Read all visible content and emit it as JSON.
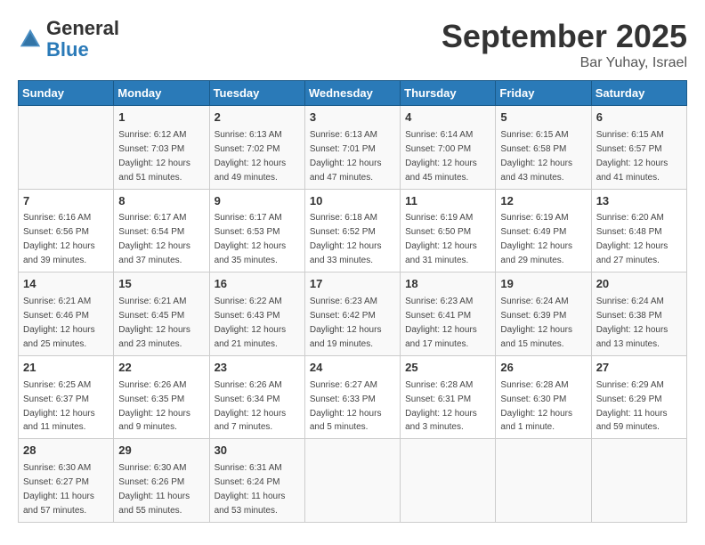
{
  "header": {
    "logo_general": "General",
    "logo_blue": "Blue",
    "month_title": "September 2025",
    "location": "Bar Yuhay, Israel"
  },
  "days_of_week": [
    "Sunday",
    "Monday",
    "Tuesday",
    "Wednesday",
    "Thursday",
    "Friday",
    "Saturday"
  ],
  "weeks": [
    [
      {
        "day": "",
        "info": ""
      },
      {
        "day": "1",
        "info": "Sunrise: 6:12 AM\nSunset: 7:03 PM\nDaylight: 12 hours\nand 51 minutes."
      },
      {
        "day": "2",
        "info": "Sunrise: 6:13 AM\nSunset: 7:02 PM\nDaylight: 12 hours\nand 49 minutes."
      },
      {
        "day": "3",
        "info": "Sunrise: 6:13 AM\nSunset: 7:01 PM\nDaylight: 12 hours\nand 47 minutes."
      },
      {
        "day": "4",
        "info": "Sunrise: 6:14 AM\nSunset: 7:00 PM\nDaylight: 12 hours\nand 45 minutes."
      },
      {
        "day": "5",
        "info": "Sunrise: 6:15 AM\nSunset: 6:58 PM\nDaylight: 12 hours\nand 43 minutes."
      },
      {
        "day": "6",
        "info": "Sunrise: 6:15 AM\nSunset: 6:57 PM\nDaylight: 12 hours\nand 41 minutes."
      }
    ],
    [
      {
        "day": "7",
        "info": "Sunrise: 6:16 AM\nSunset: 6:56 PM\nDaylight: 12 hours\nand 39 minutes."
      },
      {
        "day": "8",
        "info": "Sunrise: 6:17 AM\nSunset: 6:54 PM\nDaylight: 12 hours\nand 37 minutes."
      },
      {
        "day": "9",
        "info": "Sunrise: 6:17 AM\nSunset: 6:53 PM\nDaylight: 12 hours\nand 35 minutes."
      },
      {
        "day": "10",
        "info": "Sunrise: 6:18 AM\nSunset: 6:52 PM\nDaylight: 12 hours\nand 33 minutes."
      },
      {
        "day": "11",
        "info": "Sunrise: 6:19 AM\nSunset: 6:50 PM\nDaylight: 12 hours\nand 31 minutes."
      },
      {
        "day": "12",
        "info": "Sunrise: 6:19 AM\nSunset: 6:49 PM\nDaylight: 12 hours\nand 29 minutes."
      },
      {
        "day": "13",
        "info": "Sunrise: 6:20 AM\nSunset: 6:48 PM\nDaylight: 12 hours\nand 27 minutes."
      }
    ],
    [
      {
        "day": "14",
        "info": "Sunrise: 6:21 AM\nSunset: 6:46 PM\nDaylight: 12 hours\nand 25 minutes."
      },
      {
        "day": "15",
        "info": "Sunrise: 6:21 AM\nSunset: 6:45 PM\nDaylight: 12 hours\nand 23 minutes."
      },
      {
        "day": "16",
        "info": "Sunrise: 6:22 AM\nSunset: 6:43 PM\nDaylight: 12 hours\nand 21 minutes."
      },
      {
        "day": "17",
        "info": "Sunrise: 6:23 AM\nSunset: 6:42 PM\nDaylight: 12 hours\nand 19 minutes."
      },
      {
        "day": "18",
        "info": "Sunrise: 6:23 AM\nSunset: 6:41 PM\nDaylight: 12 hours\nand 17 minutes."
      },
      {
        "day": "19",
        "info": "Sunrise: 6:24 AM\nSunset: 6:39 PM\nDaylight: 12 hours\nand 15 minutes."
      },
      {
        "day": "20",
        "info": "Sunrise: 6:24 AM\nSunset: 6:38 PM\nDaylight: 12 hours\nand 13 minutes."
      }
    ],
    [
      {
        "day": "21",
        "info": "Sunrise: 6:25 AM\nSunset: 6:37 PM\nDaylight: 12 hours\nand 11 minutes."
      },
      {
        "day": "22",
        "info": "Sunrise: 6:26 AM\nSunset: 6:35 PM\nDaylight: 12 hours\nand 9 minutes."
      },
      {
        "day": "23",
        "info": "Sunrise: 6:26 AM\nSunset: 6:34 PM\nDaylight: 12 hours\nand 7 minutes."
      },
      {
        "day": "24",
        "info": "Sunrise: 6:27 AM\nSunset: 6:33 PM\nDaylight: 12 hours\nand 5 minutes."
      },
      {
        "day": "25",
        "info": "Sunrise: 6:28 AM\nSunset: 6:31 PM\nDaylight: 12 hours\nand 3 minutes."
      },
      {
        "day": "26",
        "info": "Sunrise: 6:28 AM\nSunset: 6:30 PM\nDaylight: 12 hours\nand 1 minute."
      },
      {
        "day": "27",
        "info": "Sunrise: 6:29 AM\nSunset: 6:29 PM\nDaylight: 11 hours\nand 59 minutes."
      }
    ],
    [
      {
        "day": "28",
        "info": "Sunrise: 6:30 AM\nSunset: 6:27 PM\nDaylight: 11 hours\nand 57 minutes."
      },
      {
        "day": "29",
        "info": "Sunrise: 6:30 AM\nSunset: 6:26 PM\nDaylight: 11 hours\nand 55 minutes."
      },
      {
        "day": "30",
        "info": "Sunrise: 6:31 AM\nSunset: 6:24 PM\nDaylight: 11 hours\nand 53 minutes."
      },
      {
        "day": "",
        "info": ""
      },
      {
        "day": "",
        "info": ""
      },
      {
        "day": "",
        "info": ""
      },
      {
        "day": "",
        "info": ""
      }
    ]
  ]
}
